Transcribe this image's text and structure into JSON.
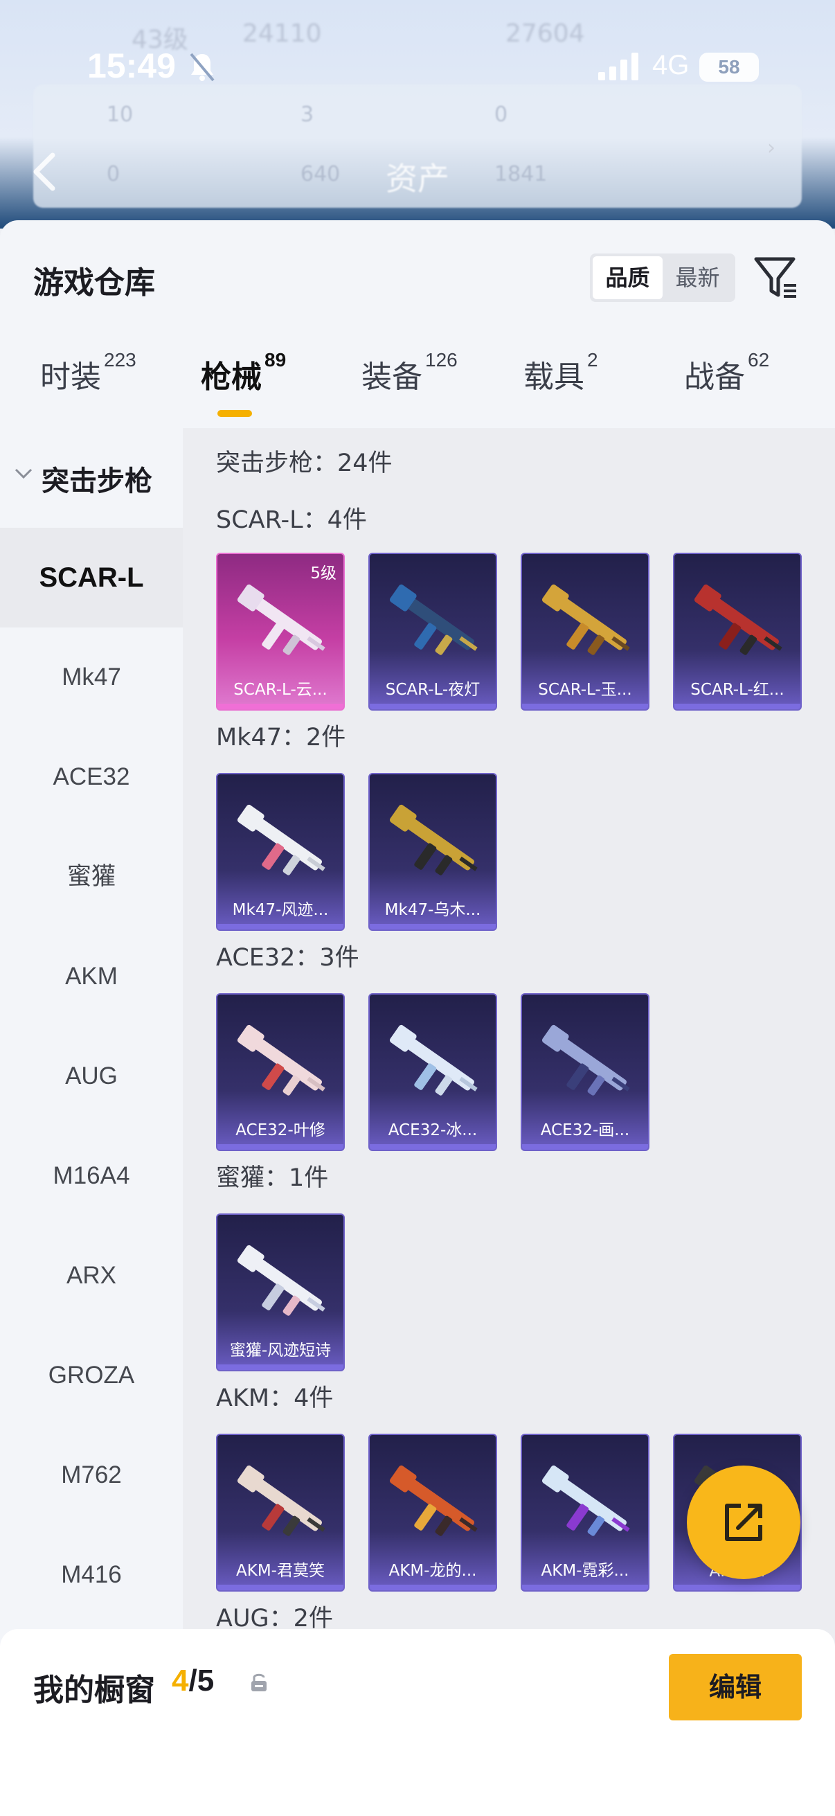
{
  "background": {
    "level": "43级",
    "coins": "24110",
    "points": "27604",
    "panel_values": [
      "10",
      "3",
      "0",
      "0",
      "640",
      "1841"
    ],
    "title": "资产"
  },
  "status_bar": {
    "time": "15:49",
    "network": "4G",
    "battery": "58"
  },
  "sheet": {
    "title": "游戏仓库",
    "sort_options": [
      "品质",
      "最新"
    ],
    "active_sort": "品质"
  },
  "tabs": [
    {
      "label": "时装",
      "count": "223"
    },
    {
      "label": "枪械",
      "count": "89"
    },
    {
      "label": "装备",
      "count": "126"
    },
    {
      "label": "载具",
      "count": "2"
    },
    {
      "label": "战备",
      "count": "62"
    }
  ],
  "sidebar": {
    "group": "突击步枪",
    "items": [
      "SCAR-L",
      "Mk47",
      "ACE32",
      "蜜獾",
      "AKM",
      "AUG",
      "M16A4",
      "ARX",
      "GROZA",
      "M762",
      "M416"
    ]
  },
  "content": {
    "total": "突击步枪：24件",
    "groups": [
      {
        "title": "SCAR-L：4件",
        "items": [
          {
            "name": "SCAR-L-云...",
            "level": "5级"
          },
          {
            "name": "SCAR-L-夜灯"
          },
          {
            "name": "SCAR-L-玉..."
          },
          {
            "name": "SCAR-L-红..."
          }
        ]
      },
      {
        "title": "Mk47：2件",
        "items": [
          {
            "name": "Mk47-风迹..."
          },
          {
            "name": "Mk47-乌木..."
          }
        ]
      },
      {
        "title": "ACE32：3件",
        "items": [
          {
            "name": "ACE32-叶修"
          },
          {
            "name": "ACE32-冰..."
          },
          {
            "name": "ACE32-画..."
          }
        ]
      },
      {
        "title": "蜜獾：1件",
        "items": [
          {
            "name": "蜜獾-风迹短诗"
          }
        ]
      },
      {
        "title": "AKM：4件",
        "items": [
          {
            "name": "AKM-君莫笑"
          },
          {
            "name": "AKM-龙的..."
          },
          {
            "name": "AKM-霓彩..."
          },
          {
            "name": "AKM-..."
          }
        ]
      },
      {
        "title": "AUG：2件",
        "items": []
      }
    ]
  },
  "bottom": {
    "title": "我的橱窗",
    "current": "4",
    "total": "/5",
    "edit_label": "编辑"
  },
  "colors": {
    "accent": "#f5b000",
    "card_purple": "#35306a",
    "card_pink": "#c53fa4"
  }
}
